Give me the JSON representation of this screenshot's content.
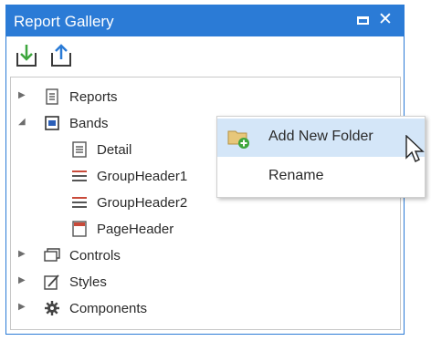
{
  "window": {
    "title": "Report Gallery"
  },
  "titlebar_buttons": {
    "maximize_icon": "maximize-icon",
    "close_glyph": "✕"
  },
  "toolbar": {
    "import_icon": "import-icon",
    "export_icon": "export-icon"
  },
  "colors": {
    "accent": "#2b7bd6",
    "highlight": "#d4e6f8",
    "icon_red": "#c94a3a",
    "icon_green": "#3da63d"
  },
  "tree": {
    "nodes": [
      {
        "label": "Reports",
        "level": 0,
        "expander": "collapsed",
        "icon": "report-icon"
      },
      {
        "label": "Bands",
        "level": 0,
        "expander": "expanded",
        "icon": "bands-icon",
        "selected": true
      },
      {
        "label": "Detail",
        "level": 1,
        "icon": "detail-band-icon"
      },
      {
        "label": "GroupHeader1",
        "level": 1,
        "icon": "group-header-icon"
      },
      {
        "label": "GroupHeader2",
        "level": 1,
        "icon": "group-header-icon"
      },
      {
        "label": "PageHeader",
        "level": 1,
        "icon": "page-header-icon"
      },
      {
        "label": "Controls",
        "level": 0,
        "expander": "collapsed",
        "icon": "controls-icon"
      },
      {
        "label": "Styles",
        "level": 0,
        "expander": "collapsed",
        "icon": "styles-icon"
      },
      {
        "label": "Components",
        "level": 0,
        "expander": "collapsed",
        "icon": "components-icon"
      }
    ]
  },
  "context_menu": {
    "items": [
      {
        "label": "Add New Folder",
        "icon": "add-folder-icon",
        "highlighted": true
      },
      {
        "label": "Rename"
      }
    ]
  }
}
